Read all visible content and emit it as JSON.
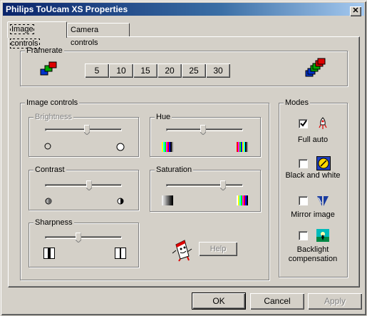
{
  "window": {
    "title": "Philips ToUcam XS Properties",
    "close_label": "x"
  },
  "tabs": [
    {
      "label": "Image controls",
      "active": true
    },
    {
      "label": "Camera controls",
      "active": false
    }
  ],
  "framerate": {
    "label": "Framerate",
    "buttons": [
      "5",
      "10",
      "15",
      "20",
      "25",
      "30"
    ]
  },
  "image_controls": {
    "label": "Image controls",
    "brightness": {
      "label": "Brightness",
      "enabled": false,
      "level": 0.55
    },
    "hue": {
      "label": "Hue",
      "level": 0.48
    },
    "contrast": {
      "label": "Contrast",
      "level": 0.57
    },
    "saturation": {
      "label": "Saturation",
      "level": 0.78
    },
    "sharpness": {
      "label": "Sharpness",
      "level": 0.43
    },
    "help_label": "Help"
  },
  "modes": {
    "label": "Modes",
    "items": [
      {
        "label": "Full auto",
        "checked": true,
        "icon": "rocket-icon"
      },
      {
        "label": "Black and white",
        "checked": false,
        "icon": "bw-palette-icon"
      },
      {
        "label": "Mirror image",
        "checked": false,
        "icon": "mirror-icon"
      },
      {
        "label": "Backlight compensation",
        "label_line1": "Backlight",
        "label_line2": "compensation",
        "checked": false,
        "icon": "backlight-icon"
      }
    ]
  },
  "footer": {
    "ok_label": "OK",
    "cancel_label": "Cancel",
    "apply_label": "Apply"
  },
  "colors": {
    "title_start": "#0a246a",
    "title_end": "#a6caf0",
    "face": "#d4d0c8"
  }
}
